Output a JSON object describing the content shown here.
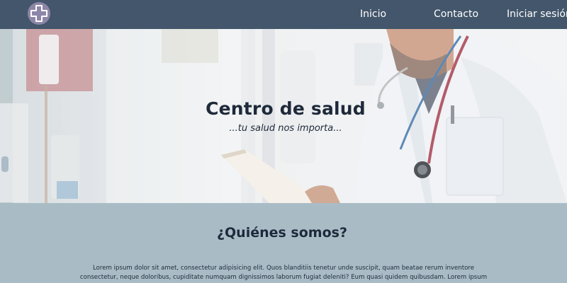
{
  "header": {
    "logo_icon": "medical-cross-icon",
    "nav": {
      "inicio": "Inicio",
      "contacto": "Contacto",
      "login": "Iniciar sesión"
    },
    "background": "#43566b"
  },
  "hero": {
    "title": "Centro de salud",
    "subtitle": "...tu salud nos importa..."
  },
  "about": {
    "heading": "¿Quiénes somos?",
    "text": "Lorem ipsum dolor sit amet, consectetur adipisicing elit. Quos blanditiis tenetur unde suscipit, quam beatae rerum inventore consectetur, neque doloribus, cupiditate numquam dignissimos laborum fugiat deleniti? Eum quasi quidem quibusdam. Lorem ipsum dolor sit amet, consectetur",
    "background": "#a9bcc6"
  }
}
